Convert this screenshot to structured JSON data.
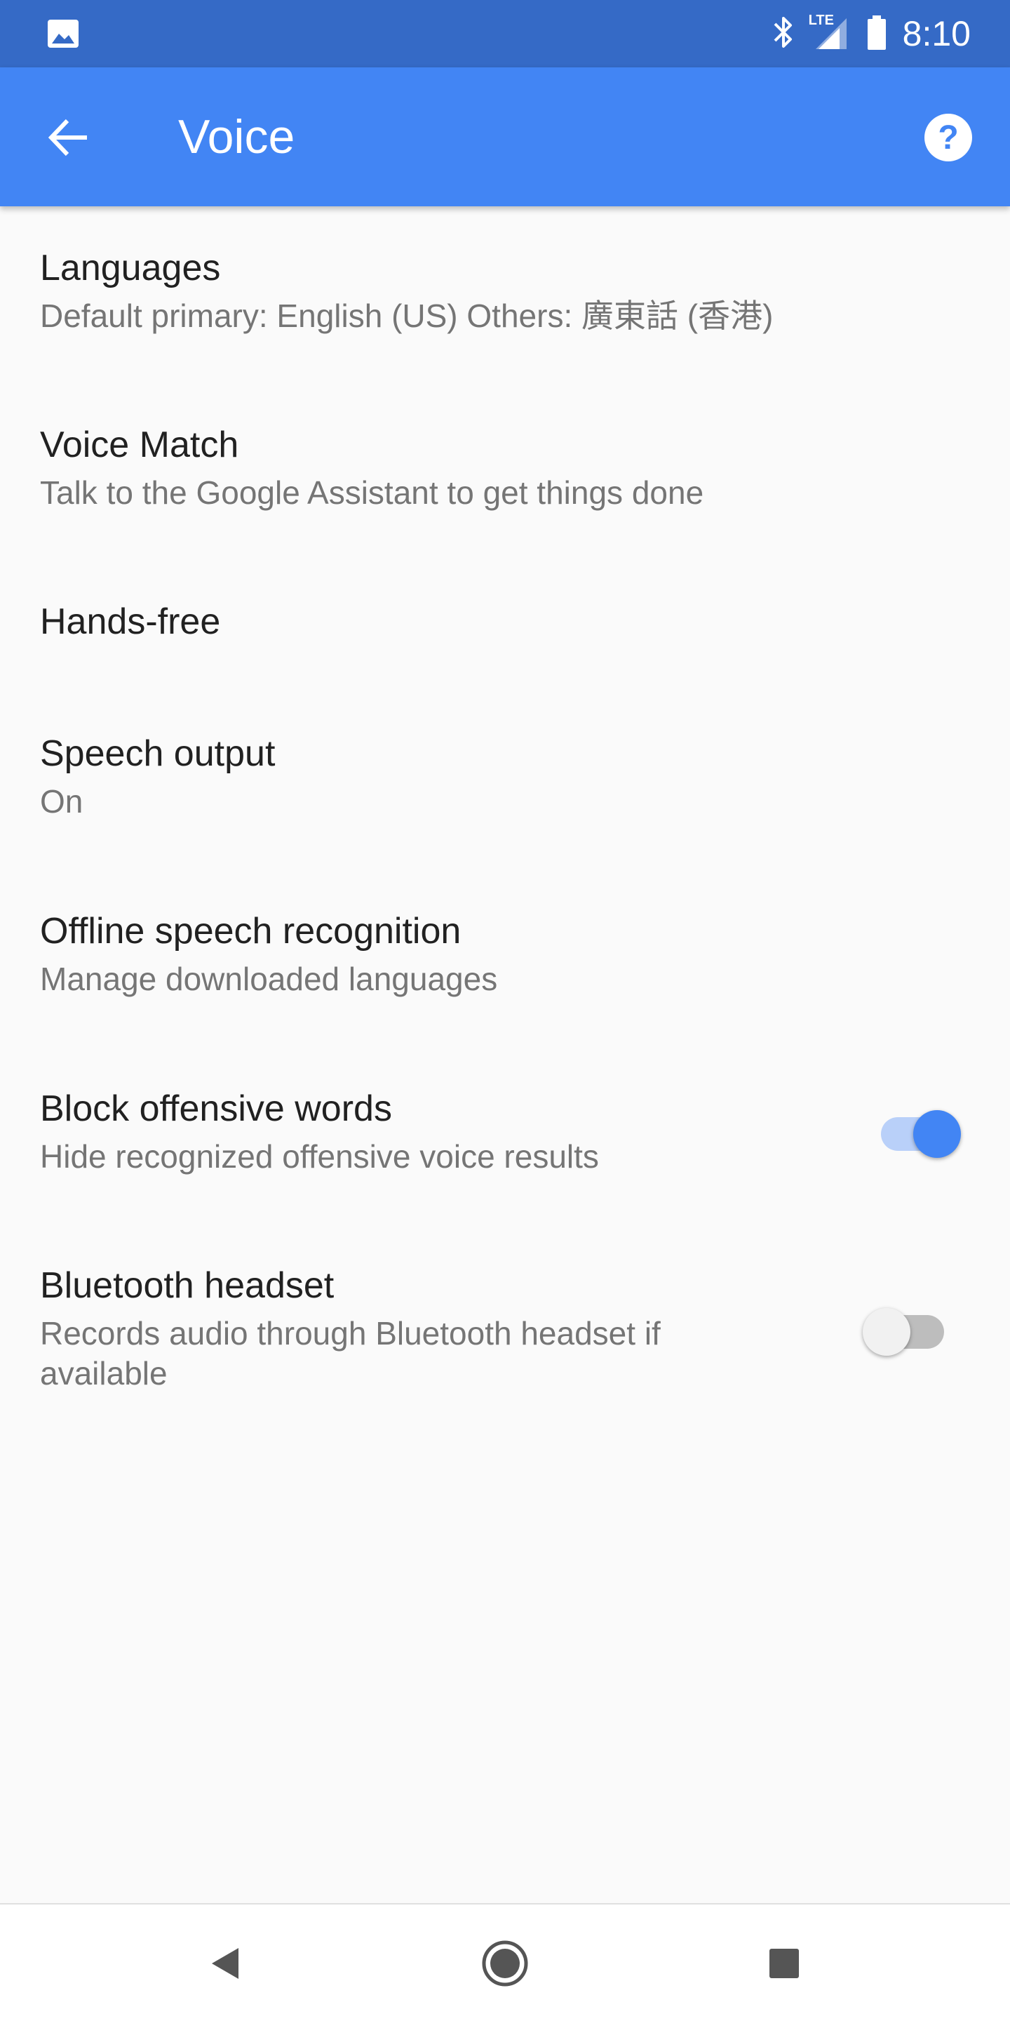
{
  "status_bar": {
    "time": "8:10",
    "network_label": "LTE",
    "icons": [
      "image-icon",
      "bluetooth-icon",
      "signal-icon",
      "battery-icon"
    ]
  },
  "app_bar": {
    "title": "Voice",
    "back_icon": "arrow-back-icon",
    "help_icon": "help-icon",
    "color": "#4285f4"
  },
  "settings": [
    {
      "title": "Languages",
      "subtitle": "Default primary: English (US) Others: 廣東話 (香港)"
    },
    {
      "title": "Voice Match",
      "subtitle": "Talk to the Google Assistant to get things done"
    },
    {
      "title": "Hands-free",
      "subtitle": ""
    },
    {
      "title": "Speech output",
      "subtitle": "On"
    },
    {
      "title": "Offline speech recognition",
      "subtitle": "Manage downloaded languages"
    },
    {
      "title": "Block offensive words",
      "subtitle": "Hide recognized offensive voice results",
      "toggle": true,
      "enabled": true
    },
    {
      "title": "Bluetooth headset",
      "subtitle": "Records audio through Bluetooth headset if available",
      "toggle": true,
      "enabled": false
    }
  ],
  "nav_bar": {
    "buttons": [
      "back-triangle-icon",
      "home-circle-icon",
      "recents-square-icon"
    ]
  },
  "colors": {
    "status_bar": "#356ac6",
    "accent": "#4285f4",
    "background": "#fafafa",
    "title_text": "#212121",
    "subtitle_text": "#757575"
  }
}
